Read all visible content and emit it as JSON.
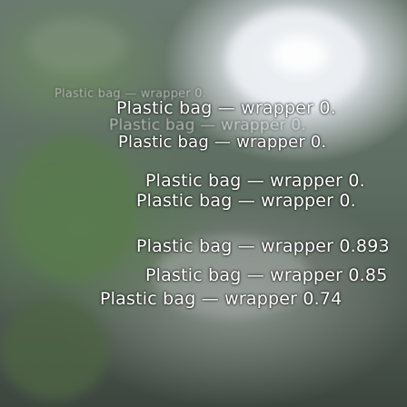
{
  "detections": [
    {
      "label": "Plastic bag — wrapper 0."
    },
    {
      "label": "Plastic bag — wrapper 0."
    },
    {
      "label": "Plastic bag — wrapper 0.893"
    },
    {
      "label": "Plastic bag — wrapper 0.85"
    },
    {
      "label": "Plastic bag — wrapper 0.74"
    },
    {
      "label": "Plastic bag — wrapper 0."
    },
    {
      "label": "Plastic bag — wrapper 0."
    }
  ],
  "colors": {
    "text": "#ffffff",
    "glass": "#e9edf0",
    "foliage": "#5f7e56"
  }
}
